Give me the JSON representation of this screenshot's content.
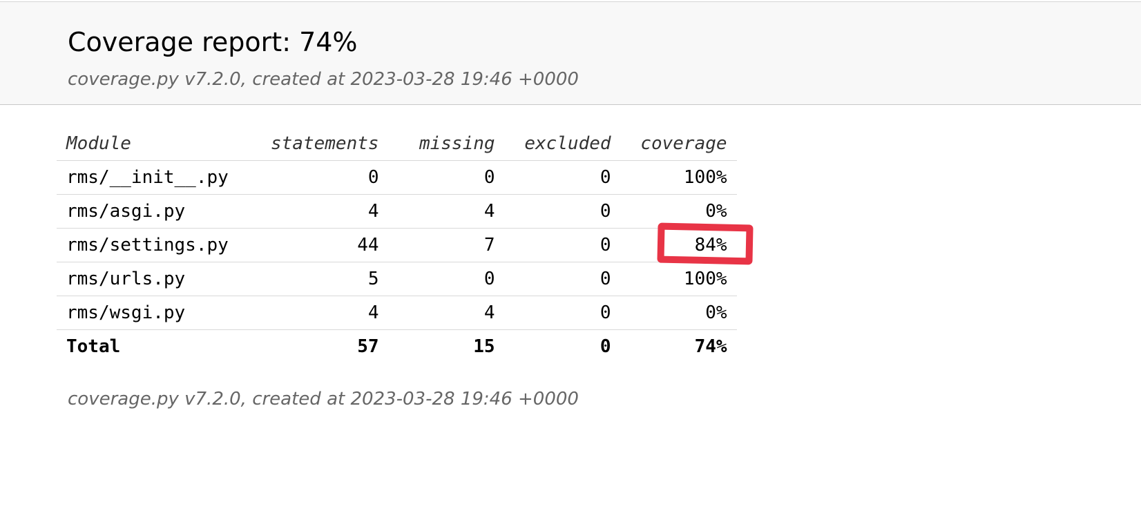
{
  "header": {
    "title": "Coverage report: 74%",
    "created": "coverage.py v7.2.0, created at 2023-03-28 19:46 +0000"
  },
  "table": {
    "columns": [
      "Module",
      "statements",
      "missing",
      "excluded",
      "coverage"
    ],
    "rows": [
      {
        "module": "rms/__init__.py",
        "statements": "0",
        "missing": "0",
        "excluded": "0",
        "coverage": "100%"
      },
      {
        "module": "rms/asgi.py",
        "statements": "4",
        "missing": "4",
        "excluded": "0",
        "coverage": "0%"
      },
      {
        "module": "rms/settings.py",
        "statements": "44",
        "missing": "7",
        "excluded": "0",
        "coverage": "84%"
      },
      {
        "module": "rms/urls.py",
        "statements": "5",
        "missing": "0",
        "excluded": "0",
        "coverage": "100%"
      },
      {
        "module": "rms/wsgi.py",
        "statements": "4",
        "missing": "4",
        "excluded": "0",
        "coverage": "0%"
      }
    ],
    "total": {
      "module": "Total",
      "statements": "57",
      "missing": "15",
      "excluded": "0",
      "coverage": "74%"
    }
  },
  "footer": {
    "created": "coverage.py v7.2.0, created at 2023-03-28 19:46 +0000"
  },
  "annotation": {
    "color": "#e83446"
  }
}
